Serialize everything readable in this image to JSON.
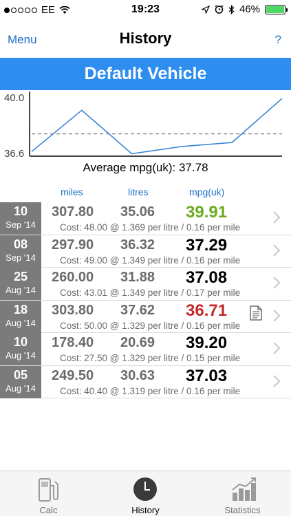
{
  "status_bar": {
    "carrier": "EE",
    "time": "19:23",
    "battery": "46%"
  },
  "nav": {
    "menu_label": "Menu",
    "title": "History",
    "help_label": "?"
  },
  "vehicle": {
    "name": "Default Vehicle"
  },
  "chart_data": {
    "type": "line",
    "y_max_label": "40.0",
    "y_min_label": "36.6",
    "ylim": [
      36.6,
      40.0
    ],
    "series": [
      {
        "values": [
          36.71,
          39.2,
          36.58,
          37.02,
          37.26,
          39.91
        ]
      }
    ],
    "average_value": 37.78,
    "average_label": "Average mpg(uk): 37.78",
    "line_color": "#2e7fd6",
    "average_style": "dashed"
  },
  "columns": {
    "miles": "miles",
    "litres": "litres",
    "mpg": "mpg(uk)"
  },
  "entries": [
    {
      "day": "10",
      "month": "Sep '14",
      "miles": "307.80",
      "litres": "35.06",
      "mpg": "39.91",
      "mpg_status": "good",
      "cost": "Cost: 48.00 @ 1.369 per litre / 0.16 per mile",
      "has_note": false
    },
    {
      "day": "08",
      "month": "Sep '14",
      "miles": "297.90",
      "litres": "36.32",
      "mpg": "37.29",
      "mpg_status": "normal",
      "cost": "Cost: 49.00 @ 1.349 per litre / 0.16 per mile",
      "has_note": false
    },
    {
      "day": "25",
      "month": "Aug '14",
      "miles": "260.00",
      "litres": "31.88",
      "mpg": "37.08",
      "mpg_status": "normal",
      "cost": "Cost: 43.01 @ 1.349 per litre / 0.17 per mile",
      "has_note": false
    },
    {
      "day": "18",
      "month": "Aug '14",
      "miles": "303.80",
      "litres": "37.62",
      "mpg": "36.71",
      "mpg_status": "bad",
      "cost": "Cost: 50.00 @ 1.329 per litre / 0.16 per mile",
      "has_note": true,
      "note_icon": "note-icon"
    },
    {
      "day": "10",
      "month": "Aug '14",
      "miles": "178.40",
      "litres": "20.69",
      "mpg": "39.20",
      "mpg_status": "normal",
      "cost": "Cost: 27.50 @ 1.329 per litre / 0.15 per mile",
      "has_note": false
    },
    {
      "day": "05",
      "month": "Aug '14",
      "miles": "249.50",
      "litres": "30.63",
      "mpg": "37.03",
      "mpg_status": "normal",
      "cost": "Cost: 40.40 @ 1.319 per litre / 0.16 per mile",
      "has_note": false
    }
  ],
  "tabs": [
    {
      "label": "Calc",
      "icon": "fuel-pump-icon",
      "active": false
    },
    {
      "label": "History",
      "icon": "clock-icon",
      "active": true
    },
    {
      "label": "Statistics",
      "icon": "chart-icon",
      "active": false
    }
  ],
  "colors": {
    "accent": "#2e8ef0",
    "good": "#6bac1e",
    "bad": "#c62a2a",
    "date_bg": "#7b7b7b"
  }
}
